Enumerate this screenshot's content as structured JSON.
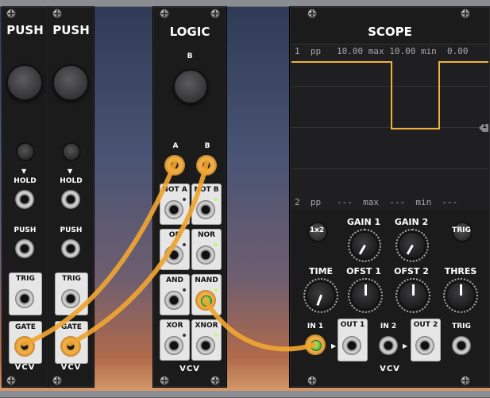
{
  "modules": {
    "push1": {
      "title": "PUSH",
      "hold": "HOLD",
      "push": "PUSH",
      "trig": "TRIG",
      "gate": "GATE",
      "brand": "VCV"
    },
    "push2": {
      "title": "PUSH",
      "hold": "HOLD",
      "push": "PUSH",
      "trig": "TRIG",
      "gate": "GATE",
      "brand": "VCV"
    },
    "logic": {
      "title": "LOGIC",
      "b_label": "B",
      "in_a": "A",
      "in_b": "B",
      "outputs": [
        "NOT A",
        "NOT B",
        "OR",
        "NOR",
        "AND",
        "NAND",
        "XOR",
        "XNOR"
      ],
      "brand": "VCV"
    },
    "scope": {
      "title": "SCOPE",
      "ch1_text": "1  pp   10.00 max 10.00 min  0.00",
      "ch2_text": "2  pp   ---  max  ---  min  ---",
      "marker": "1",
      "mode_btn": "1x2",
      "gain1": "GAIN 1",
      "gain2": "GAIN 2",
      "trig_btn": "TRIG",
      "time": "TIME",
      "ofst1": "OFST 1",
      "ofst2": "OFST 2",
      "thres": "THRES",
      "in1": "IN 1",
      "out1": "OUT 1",
      "in2": "IN 2",
      "out2": "OUT 2",
      "trig_in": "TRIG",
      "brand": "VCV"
    }
  },
  "colors": {
    "cable": "#f0a531",
    "panel": "#1b1b1c",
    "trace": "#f0b13c",
    "led_green": "#5fc03e"
  },
  "scope_trace": {
    "high_level": 10.0,
    "low_level": 0.0,
    "segments": [
      "high",
      "low",
      "high"
    ]
  }
}
